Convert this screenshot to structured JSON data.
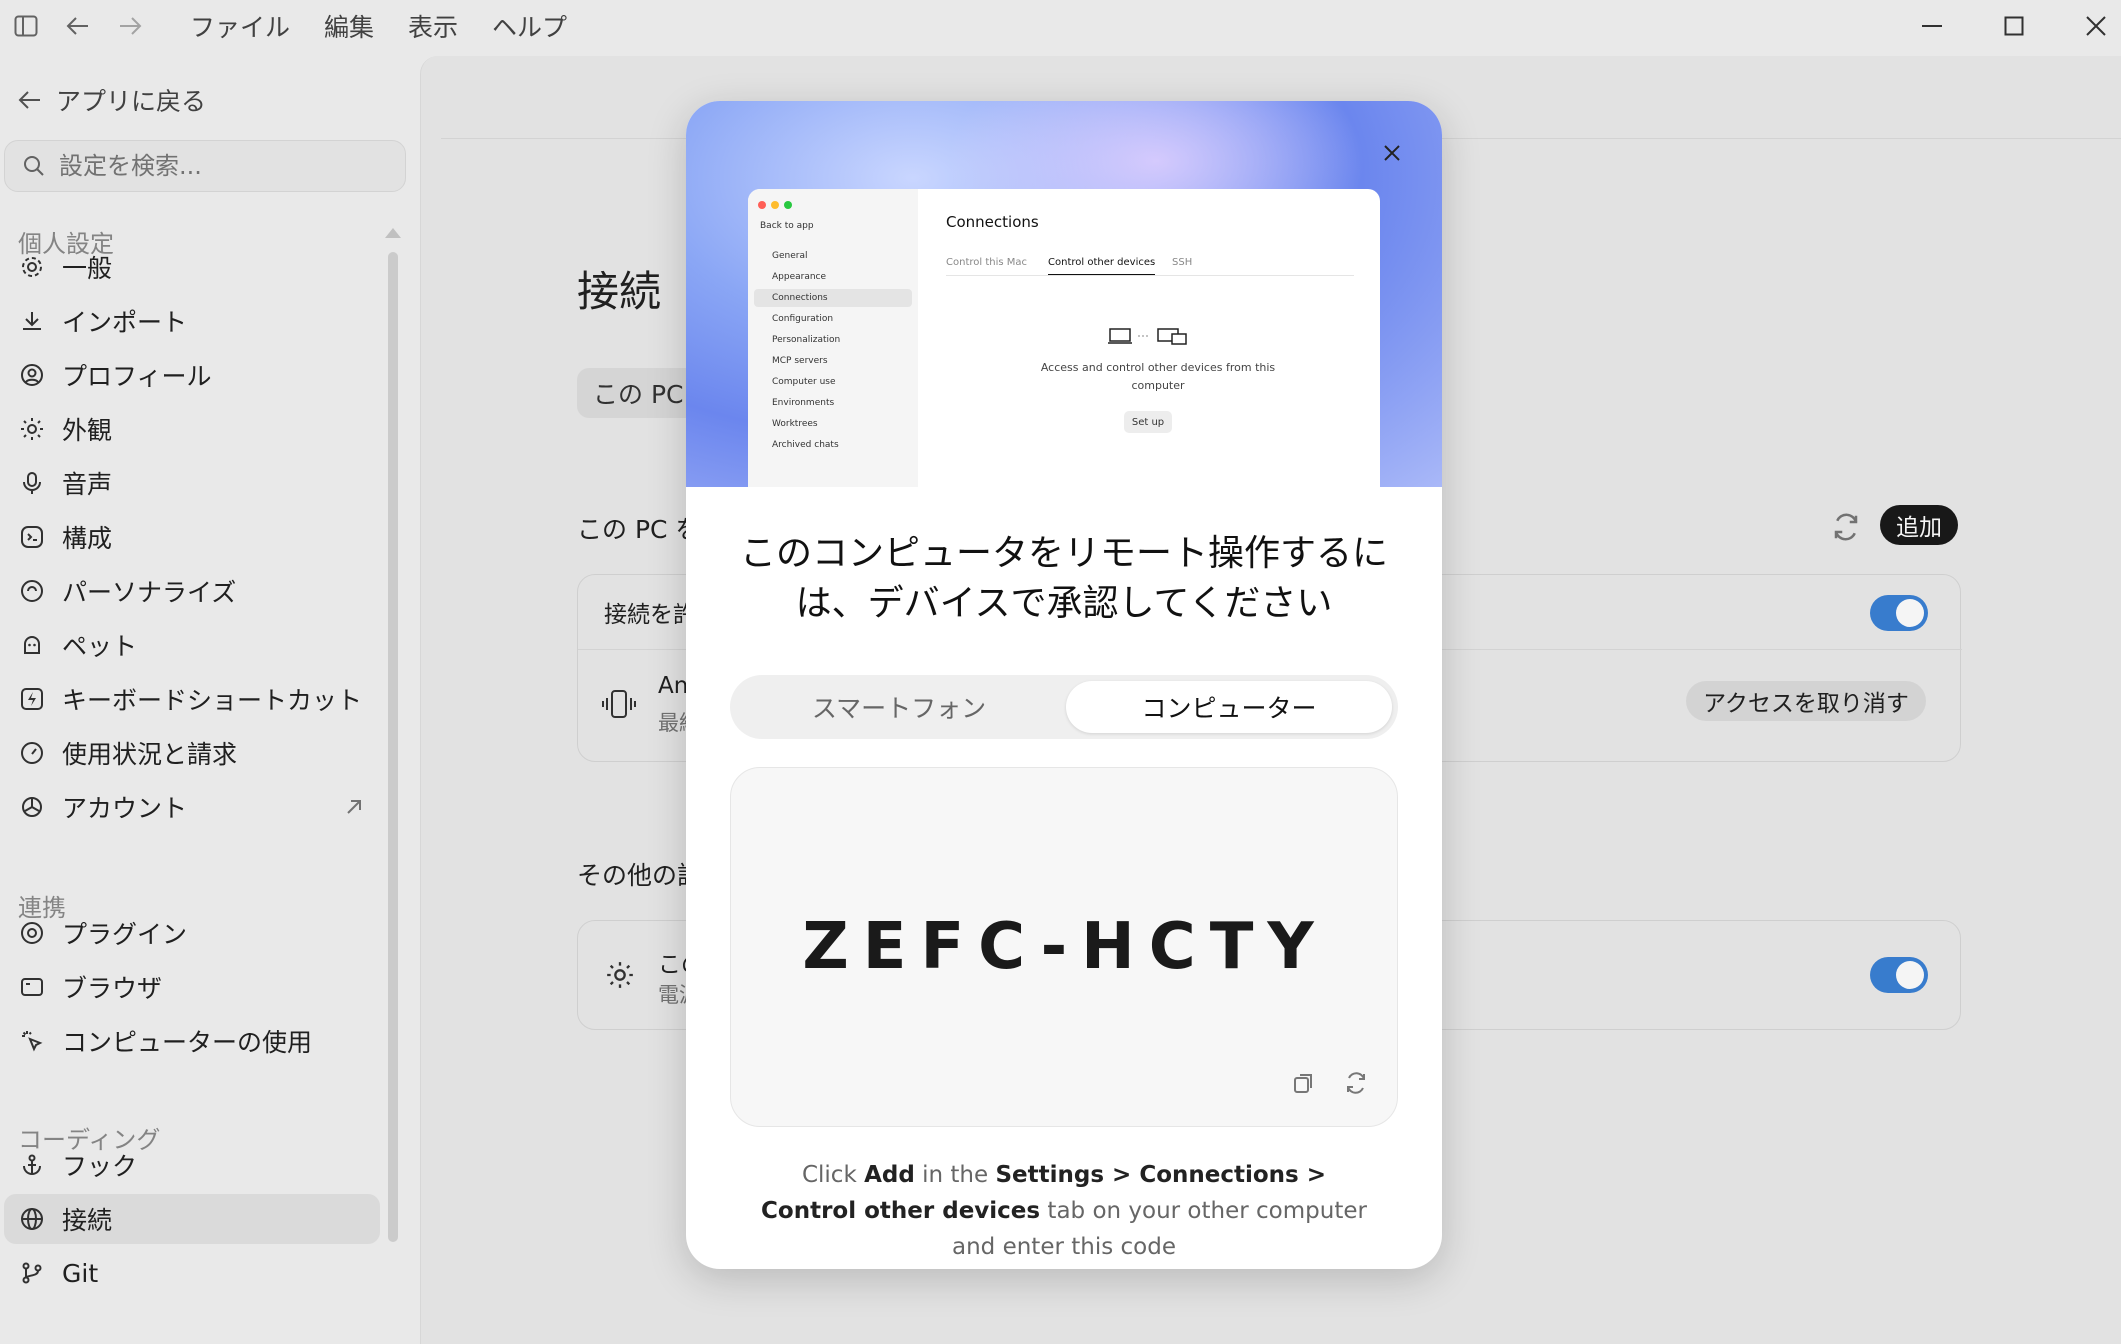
{
  "titlebar": {
    "menus": [
      "ファイル",
      "編集",
      "表示",
      "ヘルプ"
    ]
  },
  "sidebar": {
    "back_label": "アプリに戻る",
    "search_placeholder": "設定を検索...",
    "section_personal": "個人設定",
    "personal_items": [
      "一般",
      "インポート",
      "プロフィール",
      "外観",
      "音声",
      "構成",
      "パーソナライズ",
      "ペット",
      "キーボードショートカット",
      "使用状況と請求",
      "アカウント"
    ],
    "section_integrations": "連携",
    "integration_items": [
      "プラグイン",
      "ブラウザ",
      "コンピューターの使用"
    ],
    "section_coding": "コーディング",
    "coding_items": [
      "フック",
      "接続",
      "Git"
    ],
    "active_item": "接続"
  },
  "main": {
    "title": "接続",
    "segment_visible": "この PC",
    "section1_head": "この PC を",
    "add_label": "追加",
    "card1_row1_label": "接続を許",
    "card1_row2_label": "An",
    "card1_row2_sub": "最終",
    "revoke_label": "アクセスを取り消す",
    "section2_head": "その他の設",
    "card2_label": "この",
    "card2_sub": "電源"
  },
  "modal": {
    "preview": {
      "back": "Back to app",
      "items": [
        "General",
        "Appearance",
        "Connections",
        "Configuration",
        "Personalization",
        "MCP servers",
        "Computer use",
        "Environments",
        "Worktrees",
        "Archived chats"
      ],
      "active_item": "Connections",
      "title": "Connections",
      "tabs": [
        "Control this Mac",
        "Control other devices",
        "SSH"
      ],
      "active_tab": "Control other devices",
      "desc": "Access and control other devices from this computer",
      "button": "Set up"
    },
    "title_line1": "このコンピュータをリモート操作するに",
    "title_line2": "は、デバイスで承認してください",
    "tab_phone": "スマートフォン",
    "tab_computer": "コンピューター",
    "active_tab": "コンピューター",
    "code": "ZEFC-HCTY",
    "hint_parts": {
      "p1": "Click ",
      "b1": "Add",
      "p2": " in the ",
      "b2": "Settings > Connections > Control other devices",
      "p3": " tab on your other computer and enter this code"
    }
  },
  "colors": {
    "accent": "#3b82d6",
    "add_button_bg": "#1a1a1a"
  }
}
